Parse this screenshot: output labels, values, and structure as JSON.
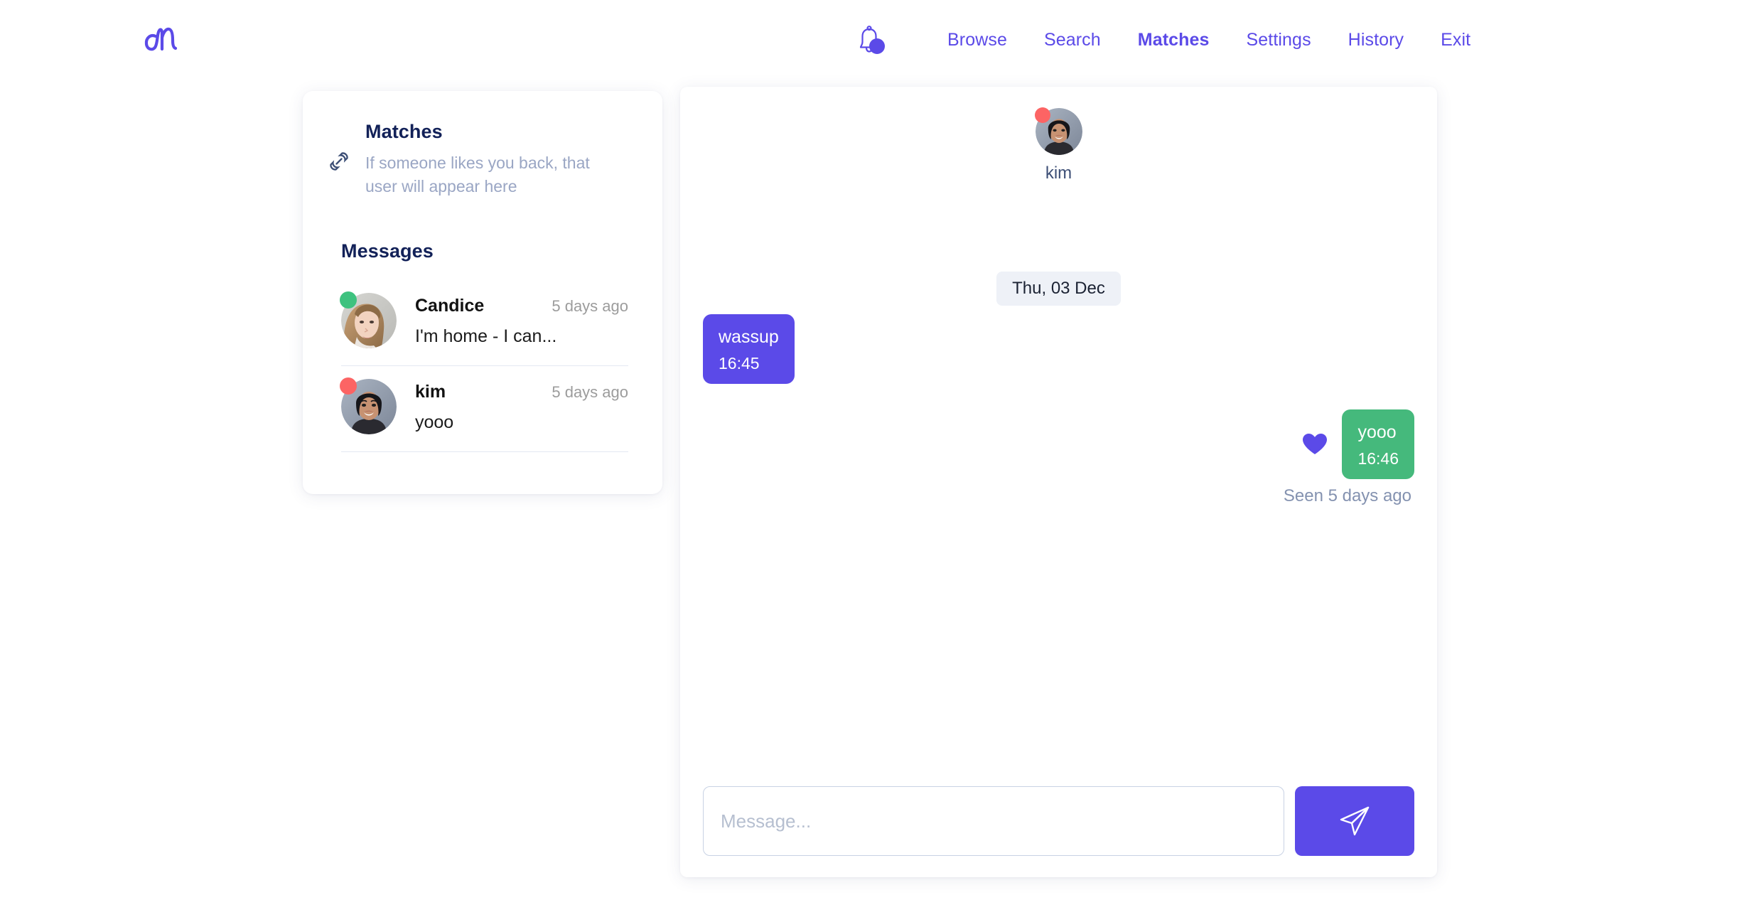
{
  "brand": {
    "logo_name": "monogram-m-logo",
    "accent_purple": "#5b4ae8",
    "accent_green": "#45b97c",
    "status_online": "#3ec27f",
    "status_offline": "#fc6464",
    "heading_navy": "#122158"
  },
  "nav": {
    "notifications_icon": "bell-icon",
    "has_notification_dot": true,
    "items": [
      {
        "label": "Browse",
        "active": false
      },
      {
        "label": "Search",
        "active": false
      },
      {
        "label": "Matches",
        "active": true
      },
      {
        "label": "Settings",
        "active": false
      },
      {
        "label": "History",
        "active": false
      },
      {
        "label": "Exit",
        "active": false
      }
    ]
  },
  "sidebar": {
    "matches": {
      "icon": "link-chain-icon",
      "title": "Matches",
      "subtitle": "If someone likes you back, that user will appear here"
    },
    "messages_heading": "Messages",
    "conversations": [
      {
        "name": "Candice",
        "time": "5 days ago",
        "preview": "I'm home - I can...",
        "status": "online",
        "avatar": "candice-avatar"
      },
      {
        "name": "kim",
        "time": "5 days ago",
        "preview": "yooo",
        "status": "offline",
        "avatar": "kim-avatar"
      }
    ]
  },
  "chat": {
    "peer_name": "kim",
    "peer_status": "offline",
    "peer_avatar": "kim-avatar",
    "date_divider": "Thu, 03 Dec",
    "messages": [
      {
        "direction": "incoming",
        "text": "wassup",
        "time": "16:45",
        "color": "purple",
        "reaction": null
      },
      {
        "direction": "outgoing",
        "text": "yooo",
        "time": "16:46",
        "color": "green",
        "reaction": "heart-icon"
      }
    ],
    "seen_status": "Seen 5 days ago",
    "composer": {
      "placeholder": "Message...",
      "value": "",
      "send_icon": "send-paper-plane-icon"
    }
  }
}
